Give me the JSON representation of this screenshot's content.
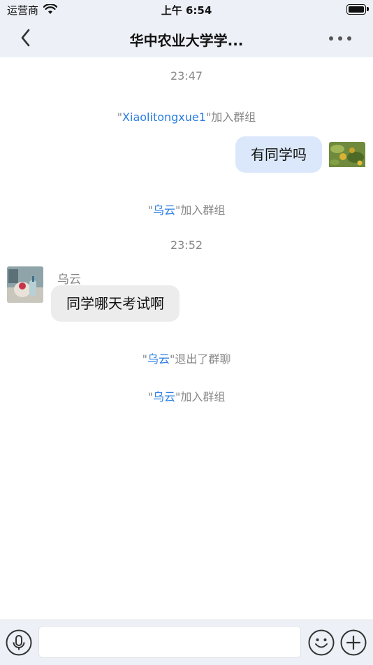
{
  "status_bar": {
    "carrier": "运营商",
    "time": "上午 6:54"
  },
  "nav": {
    "title": "华中农业大学学...",
    "back_icon": "chevron-left-icon",
    "more_icon": "more-dots-icon"
  },
  "messages": {
    "time1": "23:47",
    "join1": {
      "quote_open": "\"",
      "name": "Xiaolitongxue1",
      "quote_close": "\"",
      "action": "加入群组"
    },
    "outgoing1": "有同学吗",
    "join2": {
      "quote_open": "\"",
      "name": "乌云",
      "quote_close": "\"",
      "action": "加入群组"
    },
    "time2": "23:52",
    "incoming1": {
      "sender": "乌云",
      "text": "同学哪天考试啊"
    },
    "leave1": {
      "quote_open": "\"",
      "name": "乌云",
      "quote_close": "\"",
      "action": "退出了群聊"
    },
    "join3": {
      "quote_open": "\"",
      "name": "乌云",
      "quote_close": "\"",
      "action": "加入群组"
    }
  },
  "input_bar": {
    "message_value": "",
    "voice_icon": "microphone-icon",
    "emoji_icon": "emoji-icon",
    "plus_icon": "plus-icon"
  },
  "colors": {
    "nav_background": "#edf1f7",
    "outgoing_bubble": "#dbe8fb",
    "incoming_bubble": "#ececec",
    "name_link": "#2a7de1",
    "system_text": "#888888"
  }
}
